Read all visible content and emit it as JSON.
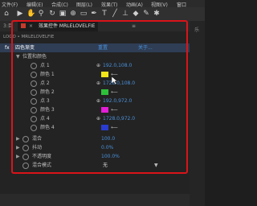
{
  "menu": [
    "文件(F)",
    "编辑(E)",
    "合成(C)",
    "图层(L)",
    "效果(T)",
    "动画(A)",
    "视图(V)",
    "窗口"
  ],
  "panel": {
    "left_tab_partial": "3:目",
    "tab_title": "效果控件 MRLELOVELFIE",
    "breadcrumb": "LOGO • MRLELOVELFIE",
    "effect_name": "四色渐变",
    "reset": "重置",
    "about": "关于...",
    "right_partial": "乐"
  },
  "rows": [
    {
      "label": "位置和颜色",
      "type": "group"
    },
    {
      "label": "点 1",
      "value": "192.0,108.0"
    },
    {
      "label": "颜色 1",
      "swatch": "#f2e61a"
    },
    {
      "label": "点 2",
      "value": "1728.0,108.0"
    },
    {
      "label": "颜色 2",
      "swatch": "#2ec13a"
    },
    {
      "label": "点 3",
      "value": "192.0,972.0"
    },
    {
      "label": "颜色 3",
      "swatch": "#e21ed6"
    },
    {
      "label": "点 4",
      "value": "1728.0,972.0"
    },
    {
      "label": "颜色 4",
      "swatch": "#2a3ccf"
    },
    {
      "label": "混合",
      "value": "100.0",
      "type": "prop"
    },
    {
      "label": "抖动",
      "value": "0.0%",
      "type": "prop"
    },
    {
      "label": "不透明度",
      "value": "100.0%",
      "type": "prop"
    },
    {
      "label": "混合模式",
      "value": "无",
      "type": "prop"
    }
  ],
  "colors": {
    "accent": "#4a90d9",
    "highlight": "#d9141a"
  }
}
